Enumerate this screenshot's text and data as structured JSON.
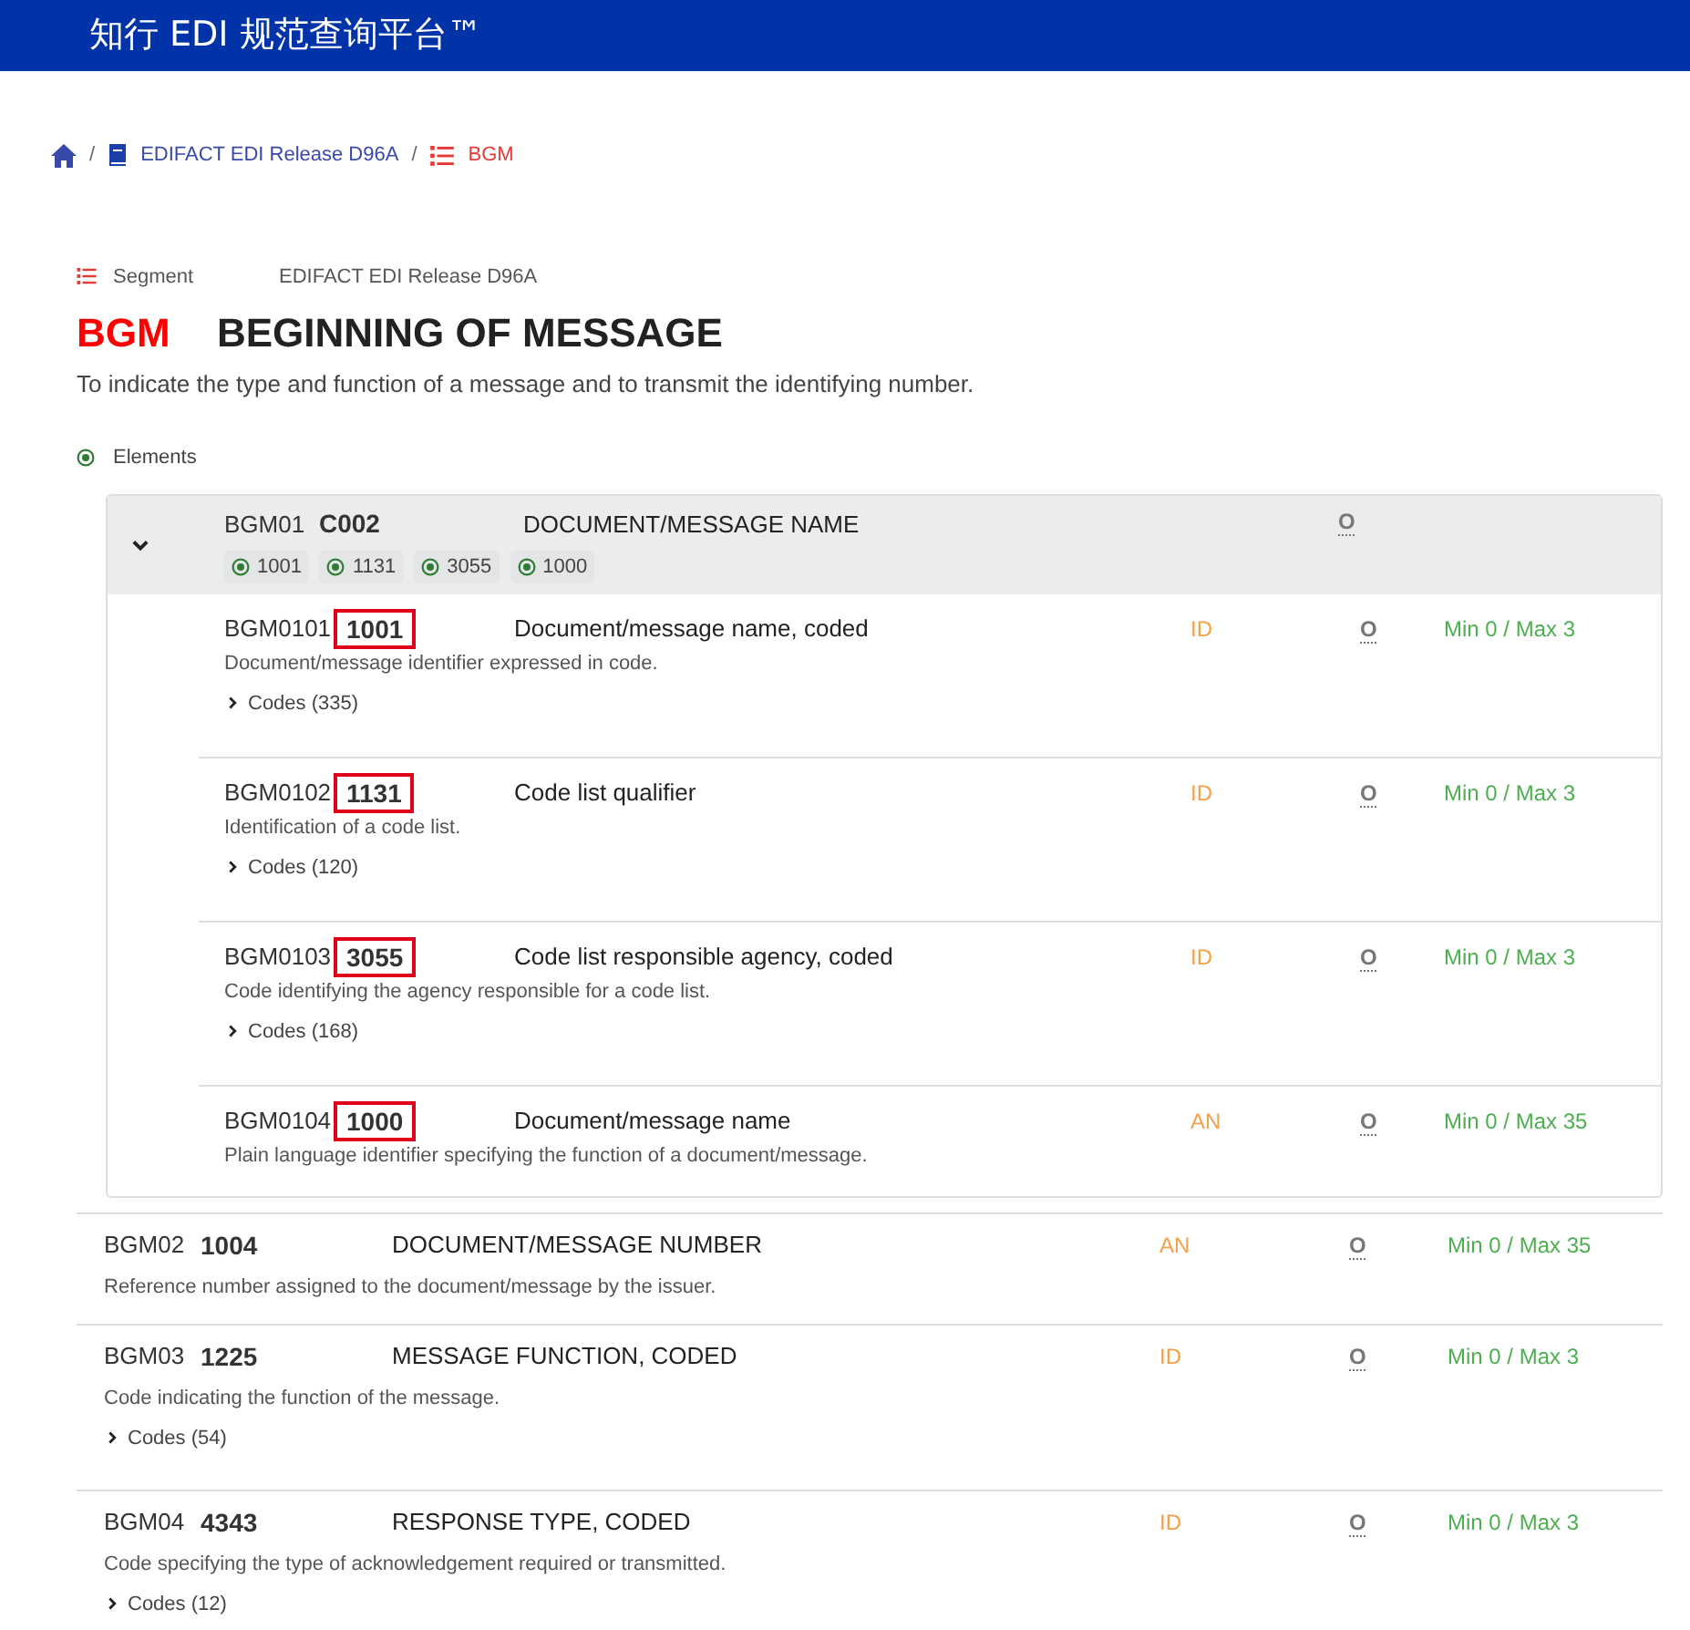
{
  "header": {
    "title": "知行 EDI 规范查询平台™"
  },
  "breadcrumb": [
    {
      "kind": "home"
    },
    {
      "kind": "standard",
      "separator": "/",
      "label": "EDIFACT EDI Release D96A"
    },
    {
      "kind": "segment",
      "separator": "/",
      "label": "BGM"
    }
  ],
  "segment": {
    "type_label": "Segment",
    "standard": "EDIFACT EDI Release D96A",
    "code": "BGM",
    "name": "BEGINNING OF MESSAGE",
    "description": "To indicate the type and function of a message and to transmit the identifying number."
  },
  "elements_label": "Elements",
  "elements": [
    {
      "kind": "composite",
      "position": "BGM01",
      "code": "C002",
      "name": "DOCUMENT/MESSAGE NAME",
      "usage": "O",
      "expanded": true,
      "components": [
        "1001",
        "1131",
        "3055",
        "1000"
      ],
      "children": [
        {
          "position": "BGM0101",
          "code": "1001",
          "name": "Document/message name, coded",
          "type": "ID",
          "usage": "O",
          "length": "Min 0 / Max 3",
          "description": "Document/message identifier expressed in code.",
          "codes": "Codes (335)",
          "highlighted": true
        },
        {
          "position": "BGM0102",
          "code": "1131",
          "name": "Code list qualifier",
          "type": "ID",
          "usage": "O",
          "length": "Min 0 / Max 3",
          "description": "Identification of a code list.",
          "codes": "Codes (120)",
          "highlighted": true
        },
        {
          "position": "BGM0103",
          "code": "3055",
          "name": "Code list responsible agency, coded",
          "type": "ID",
          "usage": "O",
          "length": "Min 0 / Max 3",
          "description": "Code identifying the agency responsible for a code list.",
          "codes": "Codes (168)",
          "highlighted": true
        },
        {
          "position": "BGM0104",
          "code": "1000",
          "name": "Document/message name",
          "type": "AN",
          "usage": "O",
          "length": "Min 0 / Max 35",
          "description": "Plain language identifier specifying the function of a document/message.",
          "highlighted": true
        }
      ]
    },
    {
      "kind": "simple",
      "position": "BGM02",
      "code": "1004",
      "name": "DOCUMENT/MESSAGE NUMBER",
      "type": "AN",
      "usage": "O",
      "length": "Min 0 / Max 35",
      "description": "Reference number assigned to the document/message by the issuer."
    },
    {
      "kind": "simple",
      "position": "BGM03",
      "code": "1225",
      "name": "MESSAGE FUNCTION, CODED",
      "type": "ID",
      "usage": "O",
      "length": "Min 0 / Max 3",
      "description": "Code indicating the function of the message.",
      "codes": "Codes (54)"
    },
    {
      "kind": "simple",
      "position": "BGM04",
      "code": "4343",
      "name": "RESPONSE TYPE, CODED",
      "type": "ID",
      "usage": "O",
      "length": "Min 0 / Max 3",
      "description": "Code specifying the type of acknowledgement required or transmitted.",
      "codes": "Codes (12)"
    }
  ]
}
